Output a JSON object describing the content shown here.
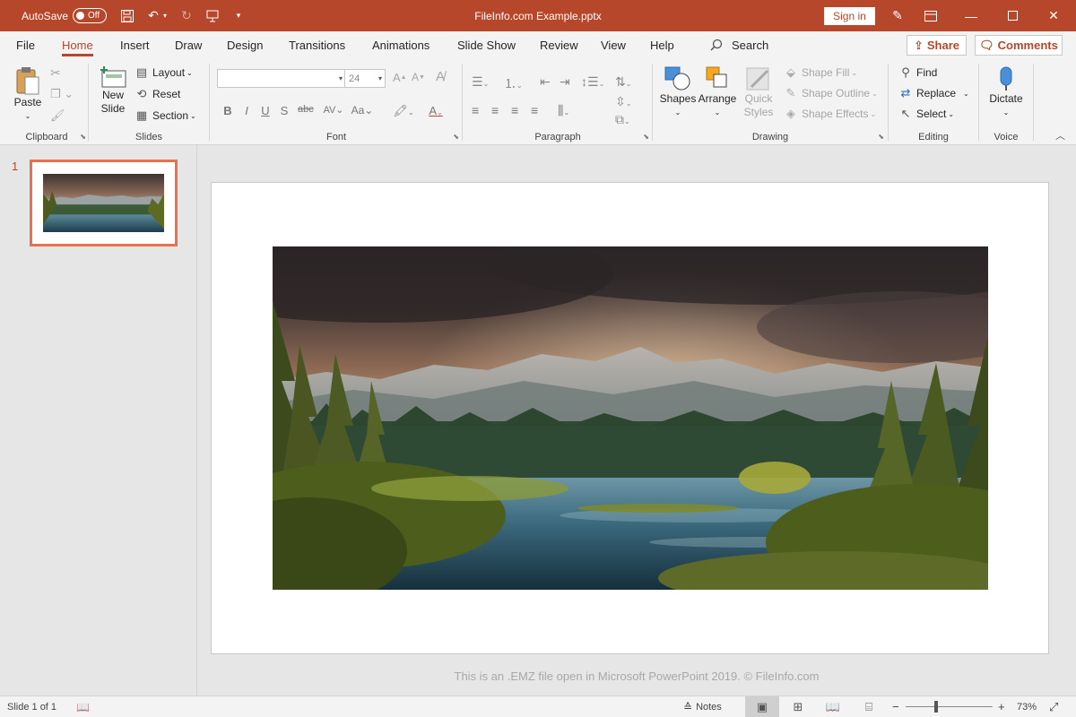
{
  "titlebar": {
    "autosave_label": "AutoSave",
    "autosave_state": "Off",
    "doc_title": "FileInfo.com Example.pptx",
    "sign_in": "Sign in",
    "colors": {
      "bar": "#b7472a"
    }
  },
  "tabs": [
    "File",
    "Home",
    "Insert",
    "Draw",
    "Design",
    "Transitions",
    "Animations",
    "Slide Show",
    "Review",
    "View",
    "Help"
  ],
  "active_tab": "Home",
  "search_label": "Search",
  "share_label": "Share",
  "comments_label": "Comments",
  "ribbon": {
    "clipboard": {
      "label": "Clipboard",
      "paste": "Paste"
    },
    "slides": {
      "label": "Slides",
      "new_slide_1": "New",
      "new_slide_2": "Slide",
      "layout": "Layout",
      "reset": "Reset",
      "section": "Section"
    },
    "font": {
      "label": "Font",
      "font_name": "",
      "font_size": "24"
    },
    "paragraph": {
      "label": "Paragraph"
    },
    "drawing": {
      "label": "Drawing",
      "shapes": "Shapes",
      "arrange": "Arrange",
      "quick_1": "Quick",
      "quick_2": "Styles",
      "shape_fill": "Shape Fill",
      "shape_outline": "Shape Outline",
      "shape_effects": "Shape Effects"
    },
    "editing": {
      "label": "Editing",
      "find": "Find",
      "replace": "Replace",
      "select": "Select"
    },
    "voice": {
      "label": "Voice",
      "dictate": "Dictate"
    }
  },
  "thumbnails": {
    "slide_number": "1"
  },
  "caption": "This is an .EMZ file open in Microsoft PowerPoint 2019. © FileInfo.com",
  "status": {
    "slide_info": "Slide 1 of 1",
    "notes": "Notes",
    "zoom": "73%",
    "zoom_minus": "−",
    "zoom_plus": "+"
  }
}
